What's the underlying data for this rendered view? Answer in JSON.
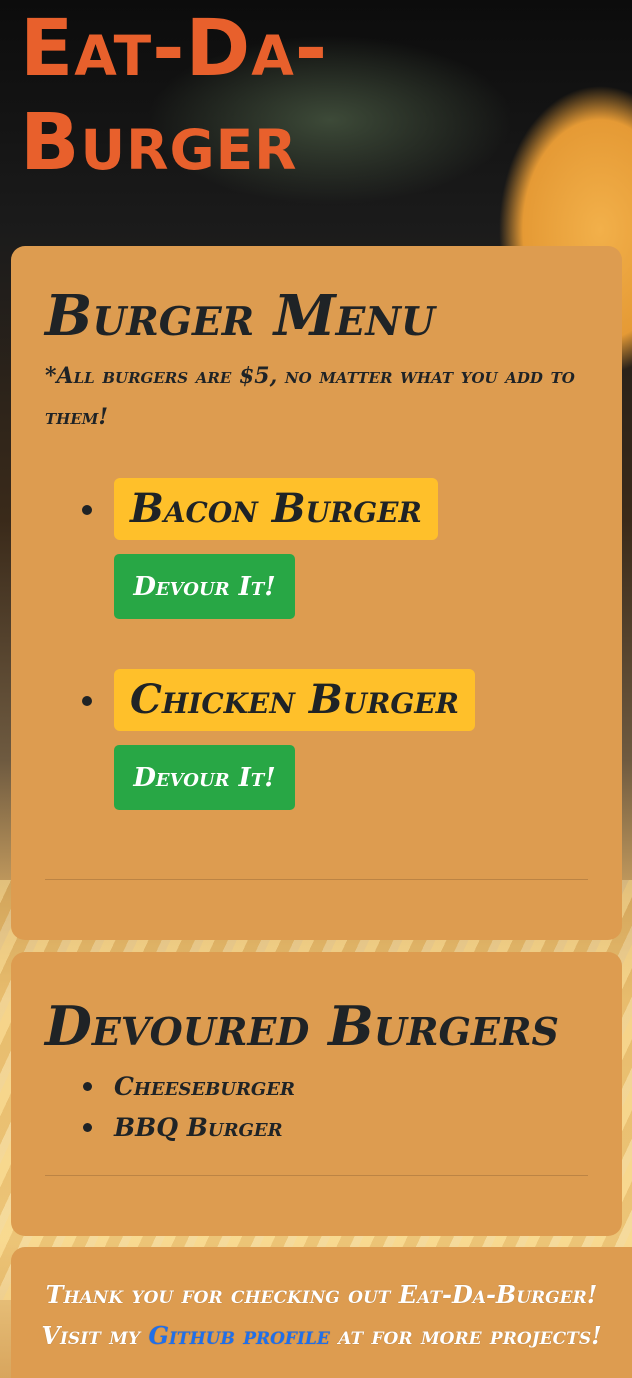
{
  "app": {
    "title": "Eat-Da-Burger"
  },
  "menu": {
    "heading": "Burger Menu",
    "note": "*All burgers are $5, no matter what you add to them!",
    "items": [
      {
        "name": "Bacon Burger",
        "button_label": "Devour It!"
      },
      {
        "name": "Chicken Burger",
        "button_label": "Devour It!"
      }
    ]
  },
  "devoured": {
    "heading": "Devoured Burgers",
    "items": [
      "Cheeseburger",
      "BBQ Burger"
    ]
  },
  "footer": {
    "line1": "Thank you for checking out Eat-Da-Burger!",
    "line2_prefix": "Visit my",
    "link_text": "Github profile",
    "line2_suffix": "at for more projects!"
  },
  "colors": {
    "title": "#e8602c",
    "card_background": "#dd9c50",
    "burger_badge": "#ffc02a",
    "devour_button": "#28a745",
    "link": "#1f6feb",
    "text": "#1f2326"
  }
}
